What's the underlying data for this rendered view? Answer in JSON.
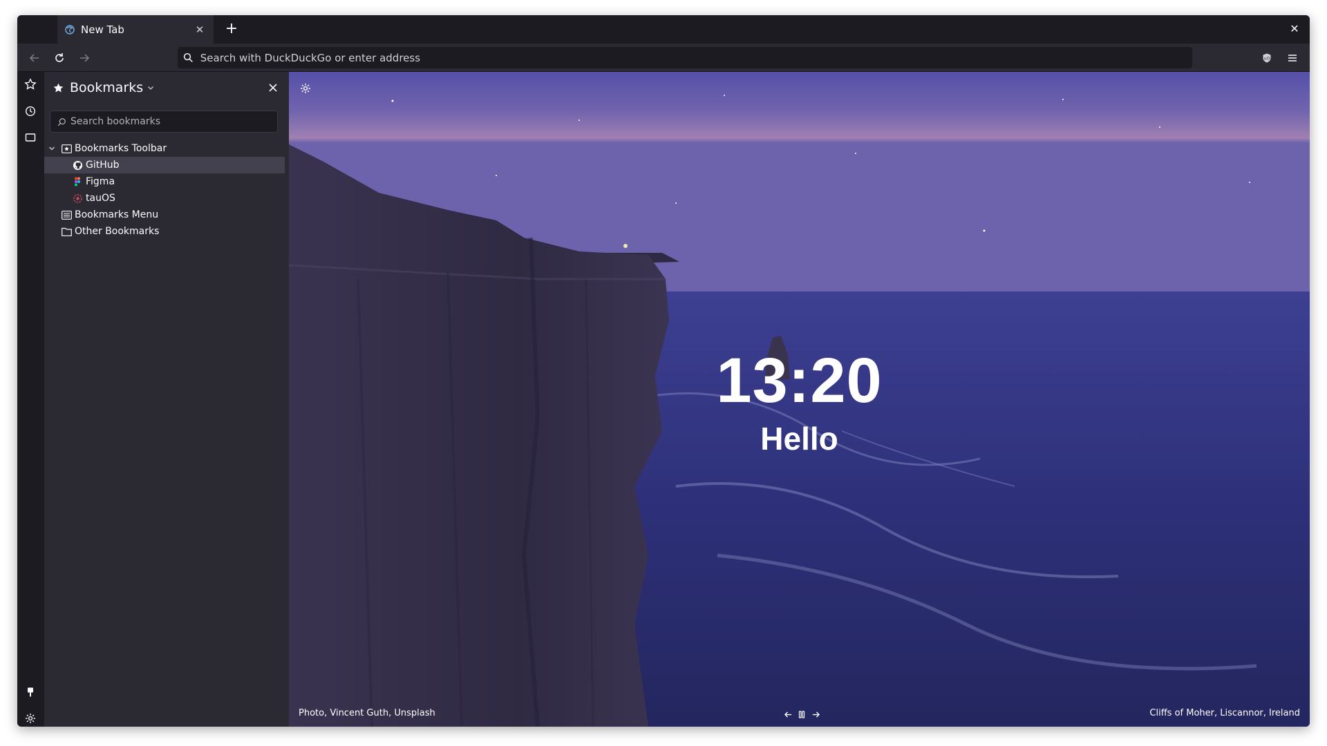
{
  "tab": {
    "title": "New Tab",
    "close_label": "✕"
  },
  "toolbar": {
    "new_tab_label": "+",
    "window_close_label": "✕"
  },
  "urlbar": {
    "placeholder": "Search with DuckDuckGo or enter address",
    "value": ""
  },
  "sidebar": {
    "title": "Bookmarks",
    "search_placeholder": "Search bookmarks",
    "tree": [
      {
        "label": "Bookmarks Toolbar",
        "icon": "toolbar-folder-icon",
        "expanded": true
      },
      {
        "label": "GitHub",
        "icon": "github-icon",
        "selected": true
      },
      {
        "label": "Figma",
        "icon": "figma-icon"
      },
      {
        "label": "tauOS",
        "icon": "tauos-icon"
      },
      {
        "label": "Bookmarks Menu",
        "icon": "menu-folder-icon"
      },
      {
        "label": "Other Bookmarks",
        "icon": "folder-icon"
      }
    ]
  },
  "newtab": {
    "time": "13:20",
    "greeting": "Hello",
    "photo_credit": "Photo, Vincent Guth, Unsplash",
    "location": "Cliffs of Moher, Liscannor, Ireland"
  },
  "colors": {
    "window_bg": "#1c1b22",
    "toolbar_bg": "#2b2a33",
    "selected_row": "#42414d",
    "text": "#fbfbfe"
  }
}
